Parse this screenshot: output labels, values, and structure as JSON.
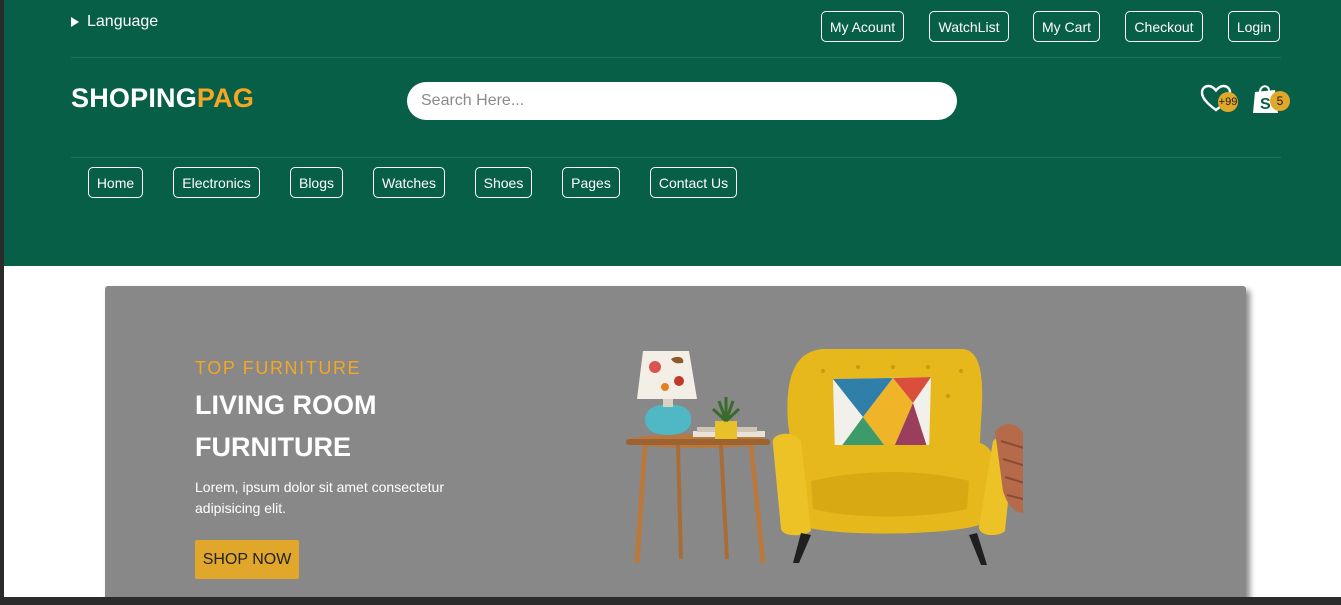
{
  "top_bar": {
    "language_label": "Language",
    "links": [
      {
        "label": "My Acount"
      },
      {
        "label": "WatchList"
      },
      {
        "label": "My Cart"
      },
      {
        "label": "Checkout"
      },
      {
        "label": "Login"
      }
    ]
  },
  "brand": {
    "part1": "SHOPING",
    "part2": "PAG",
    "part1_color": "#ffffff",
    "part2_color": "#f5a623"
  },
  "search": {
    "placeholder": "Search Here...",
    "value": ""
  },
  "icons": {
    "wishlist": {
      "icon": "heart-icon",
      "badge": "+99"
    },
    "cart": {
      "icon": "shopping-bag-icon",
      "badge": "5"
    }
  },
  "nav": {
    "items": [
      {
        "label": "Home"
      },
      {
        "label": "Electronics"
      },
      {
        "label": "Blogs"
      },
      {
        "label": "Watches"
      },
      {
        "label": "Shoes"
      },
      {
        "label": "Pages"
      },
      {
        "label": "Contact Us"
      }
    ]
  },
  "hero": {
    "eyebrow": "TOP FURNITURE",
    "title_line1": "LIVING ROOM",
    "title_line2": "FURNITURE",
    "description": "Lorem, ipsum dolor sit amet consectetur adipisicing elit.",
    "cta_label": "SHOP NOW",
    "image": "armchair-side-table-lamp-image"
  },
  "colors": {
    "header_bg": "#065f46",
    "accent": "#f5a623",
    "button_gold": "#e0a72a",
    "banner_bg": "#888888"
  }
}
